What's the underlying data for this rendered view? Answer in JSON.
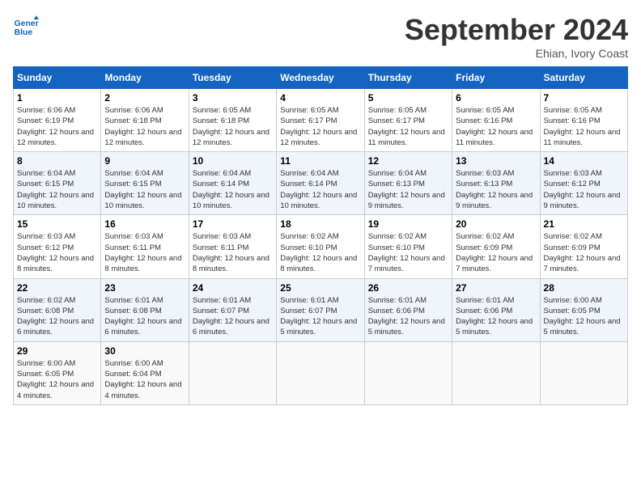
{
  "header": {
    "logo_line1": "General",
    "logo_line2": "Blue",
    "month": "September 2024",
    "location": "Ehian, Ivory Coast"
  },
  "weekdays": [
    "Sunday",
    "Monday",
    "Tuesday",
    "Wednesday",
    "Thursday",
    "Friday",
    "Saturday"
  ],
  "weeks": [
    [
      {
        "day": "1",
        "sunrise": "6:06 AM",
        "sunset": "6:19 PM",
        "daylight": "12 hours and 12 minutes."
      },
      {
        "day": "2",
        "sunrise": "6:06 AM",
        "sunset": "6:18 PM",
        "daylight": "12 hours and 12 minutes."
      },
      {
        "day": "3",
        "sunrise": "6:05 AM",
        "sunset": "6:18 PM",
        "daylight": "12 hours and 12 minutes."
      },
      {
        "day": "4",
        "sunrise": "6:05 AM",
        "sunset": "6:17 PM",
        "daylight": "12 hours and 12 minutes."
      },
      {
        "day": "5",
        "sunrise": "6:05 AM",
        "sunset": "6:17 PM",
        "daylight": "12 hours and 11 minutes."
      },
      {
        "day": "6",
        "sunrise": "6:05 AM",
        "sunset": "6:16 PM",
        "daylight": "12 hours and 11 minutes."
      },
      {
        "day": "7",
        "sunrise": "6:05 AM",
        "sunset": "6:16 PM",
        "daylight": "12 hours and 11 minutes."
      }
    ],
    [
      {
        "day": "8",
        "sunrise": "6:04 AM",
        "sunset": "6:15 PM",
        "daylight": "12 hours and 10 minutes."
      },
      {
        "day": "9",
        "sunrise": "6:04 AM",
        "sunset": "6:15 PM",
        "daylight": "12 hours and 10 minutes."
      },
      {
        "day": "10",
        "sunrise": "6:04 AM",
        "sunset": "6:14 PM",
        "daylight": "12 hours and 10 minutes."
      },
      {
        "day": "11",
        "sunrise": "6:04 AM",
        "sunset": "6:14 PM",
        "daylight": "12 hours and 10 minutes."
      },
      {
        "day": "12",
        "sunrise": "6:04 AM",
        "sunset": "6:13 PM",
        "daylight": "12 hours and 9 minutes."
      },
      {
        "day": "13",
        "sunrise": "6:03 AM",
        "sunset": "6:13 PM",
        "daylight": "12 hours and 9 minutes."
      },
      {
        "day": "14",
        "sunrise": "6:03 AM",
        "sunset": "6:12 PM",
        "daylight": "12 hours and 9 minutes."
      }
    ],
    [
      {
        "day": "15",
        "sunrise": "6:03 AM",
        "sunset": "6:12 PM",
        "daylight": "12 hours and 8 minutes."
      },
      {
        "day": "16",
        "sunrise": "6:03 AM",
        "sunset": "6:11 PM",
        "daylight": "12 hours and 8 minutes."
      },
      {
        "day": "17",
        "sunrise": "6:03 AM",
        "sunset": "6:11 PM",
        "daylight": "12 hours and 8 minutes."
      },
      {
        "day": "18",
        "sunrise": "6:02 AM",
        "sunset": "6:10 PM",
        "daylight": "12 hours and 8 minutes."
      },
      {
        "day": "19",
        "sunrise": "6:02 AM",
        "sunset": "6:10 PM",
        "daylight": "12 hours and 7 minutes."
      },
      {
        "day": "20",
        "sunrise": "6:02 AM",
        "sunset": "6:09 PM",
        "daylight": "12 hours and 7 minutes."
      },
      {
        "day": "21",
        "sunrise": "6:02 AM",
        "sunset": "6:09 PM",
        "daylight": "12 hours and 7 minutes."
      }
    ],
    [
      {
        "day": "22",
        "sunrise": "6:02 AM",
        "sunset": "6:08 PM",
        "daylight": "12 hours and 6 minutes."
      },
      {
        "day": "23",
        "sunrise": "6:01 AM",
        "sunset": "6:08 PM",
        "daylight": "12 hours and 6 minutes."
      },
      {
        "day": "24",
        "sunrise": "6:01 AM",
        "sunset": "6:07 PM",
        "daylight": "12 hours and 6 minutes."
      },
      {
        "day": "25",
        "sunrise": "6:01 AM",
        "sunset": "6:07 PM",
        "daylight": "12 hours and 5 minutes."
      },
      {
        "day": "26",
        "sunrise": "6:01 AM",
        "sunset": "6:06 PM",
        "daylight": "12 hours and 5 minutes."
      },
      {
        "day": "27",
        "sunrise": "6:01 AM",
        "sunset": "6:06 PM",
        "daylight": "12 hours and 5 minutes."
      },
      {
        "day": "28",
        "sunrise": "6:00 AM",
        "sunset": "6:05 PM",
        "daylight": "12 hours and 5 minutes."
      }
    ],
    [
      {
        "day": "29",
        "sunrise": "6:00 AM",
        "sunset": "6:05 PM",
        "daylight": "12 hours and 4 minutes."
      },
      {
        "day": "30",
        "sunrise": "6:00 AM",
        "sunset": "6:04 PM",
        "daylight": "12 hours and 4 minutes."
      },
      null,
      null,
      null,
      null,
      null
    ]
  ]
}
